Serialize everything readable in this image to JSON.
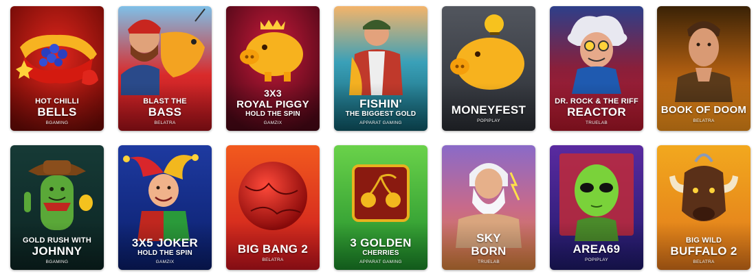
{
  "games": [
    {
      "line1": "HOT CHILLI",
      "line2": "BELLS",
      "line3": "",
      "provider": "BGAMING",
      "icon": "chilli-bells-icon"
    },
    {
      "line1": "BLAST THE",
      "line2": "BASS",
      "line3": "",
      "provider": "BELATRA",
      "icon": "fisherman-bass-icon"
    },
    {
      "line1": "3X3",
      "line2": "ROYAL PIGGY",
      "line3": "HOLD THE SPIN",
      "provider": "GAMZIX",
      "icon": "gold-piggy-icon"
    },
    {
      "line1": "",
      "line2": "FISHIN'",
      "line3": "THE BIGGEST GOLD",
      "provider": "APPARAT GAMING",
      "icon": "fisherman-icon"
    },
    {
      "line1": "",
      "line2": "MONEYFEST",
      "line3": "",
      "provider": "POPIPLAY",
      "icon": "piggy-bank-coin-icon"
    },
    {
      "line1": "DR. ROCK & THE RIFF",
      "line2": "REACTOR",
      "line3": "",
      "provider": "TRUELAB",
      "icon": "mad-scientist-icon"
    },
    {
      "line1": "",
      "line2": "BOOK OF DOOM",
      "line3": "",
      "provider": "BELATRA",
      "icon": "explorer-man-icon"
    },
    {
      "line1": "GOLD RUSH WITH",
      "line2": "JOHNNY",
      "line3": "",
      "provider": "BGAMING",
      "icon": "cactus-cowboy-icon"
    },
    {
      "line1": "",
      "line2": "3X5 JOKER",
      "line3": "HOLD THE SPIN",
      "provider": "GAMZIX",
      "icon": "jester-icon"
    },
    {
      "line1": "",
      "line2": "BIG BANG 2",
      "line3": "",
      "provider": "BELATRA",
      "icon": "red-planet-icon"
    },
    {
      "line1": "",
      "line2": "3 GOLDEN",
      "line3": "CHERRIES",
      "provider": "APPARAT GAMING",
      "icon": "golden-cherries-icon"
    },
    {
      "line1": "",
      "line2": "SKY",
      "line3": "BORN",
      "provider": "TRUELAB",
      "icon": "zeus-icon"
    },
    {
      "line1": "",
      "line2": "AREA69",
      "line3": "",
      "provider": "POPIPLAY",
      "icon": "alien-icon"
    },
    {
      "line1": "BIG WILD",
      "line2": "BUFFALO 2",
      "line3": "",
      "provider": "BELATRA",
      "icon": "buffalo-icon"
    }
  ]
}
